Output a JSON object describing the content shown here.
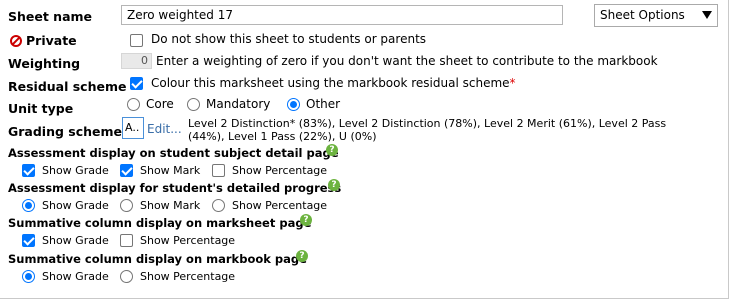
{
  "sheet_name": {
    "label": "Sheet name",
    "value": "Zero weighted 17"
  },
  "sheet_options": {
    "label": "Sheet Options"
  },
  "private": {
    "label": "Private",
    "checkbox_text": "Do not show this sheet to students or parents",
    "checked": false
  },
  "weighting": {
    "label": "Weighting",
    "value": "0",
    "hint": "Enter a weighting of zero if you don't want the sheet to contribute to the markbook"
  },
  "residual": {
    "label": "Residual scheme",
    "checkbox_text": "Colour this marksheet using the markbook residual scheme",
    "required_mark": "*",
    "checked": true
  },
  "unit_type": {
    "label": "Unit type",
    "options": [
      "Core",
      "Mandatory",
      "Other"
    ],
    "selected": "Other"
  },
  "grading": {
    "label": "Grading scheme",
    "box_text": "A..",
    "edit_label": "Edit...",
    "description_line1": "Level 2 Distinction* (83%), Level 2 Distinction (78%), Level 2 Merit (61%), Level 2 Pass",
    "description_line2": "(44%), Level 1 Pass (22%), U (0%)"
  },
  "subject_detail": {
    "heading": "Assessment display on student subject detail page",
    "show_grade": "Show Grade",
    "show_mark": "Show Mark",
    "show_percentage": "Show Percentage",
    "grade_checked": true,
    "mark_checked": true,
    "percentage_checked": false
  },
  "detailed_progress": {
    "heading": "Assessment display for student's detailed progress",
    "show_grade": "Show Grade",
    "show_mark": "Show Mark",
    "show_percentage": "Show Percentage",
    "selected": "Show Grade"
  },
  "summative_marksheet": {
    "heading": "Summative column display on marksheet page",
    "show_grade": "Show Grade",
    "show_percentage": "Show Percentage",
    "grade_checked": true,
    "percentage_checked": false
  },
  "summative_markbook": {
    "heading": "Summative column display on markbook page",
    "show_grade": "Show Grade",
    "show_percentage": "Show Percentage",
    "selected": "Show Grade"
  },
  "icons": {
    "private": "no-entry-icon",
    "help": "help-icon",
    "dropdown": "chevron-down-icon"
  },
  "colors": {
    "accent": "#0075ff",
    "help_green": "#6cb33f",
    "private_red": "#cc0000",
    "link": "#3a6ea8"
  }
}
